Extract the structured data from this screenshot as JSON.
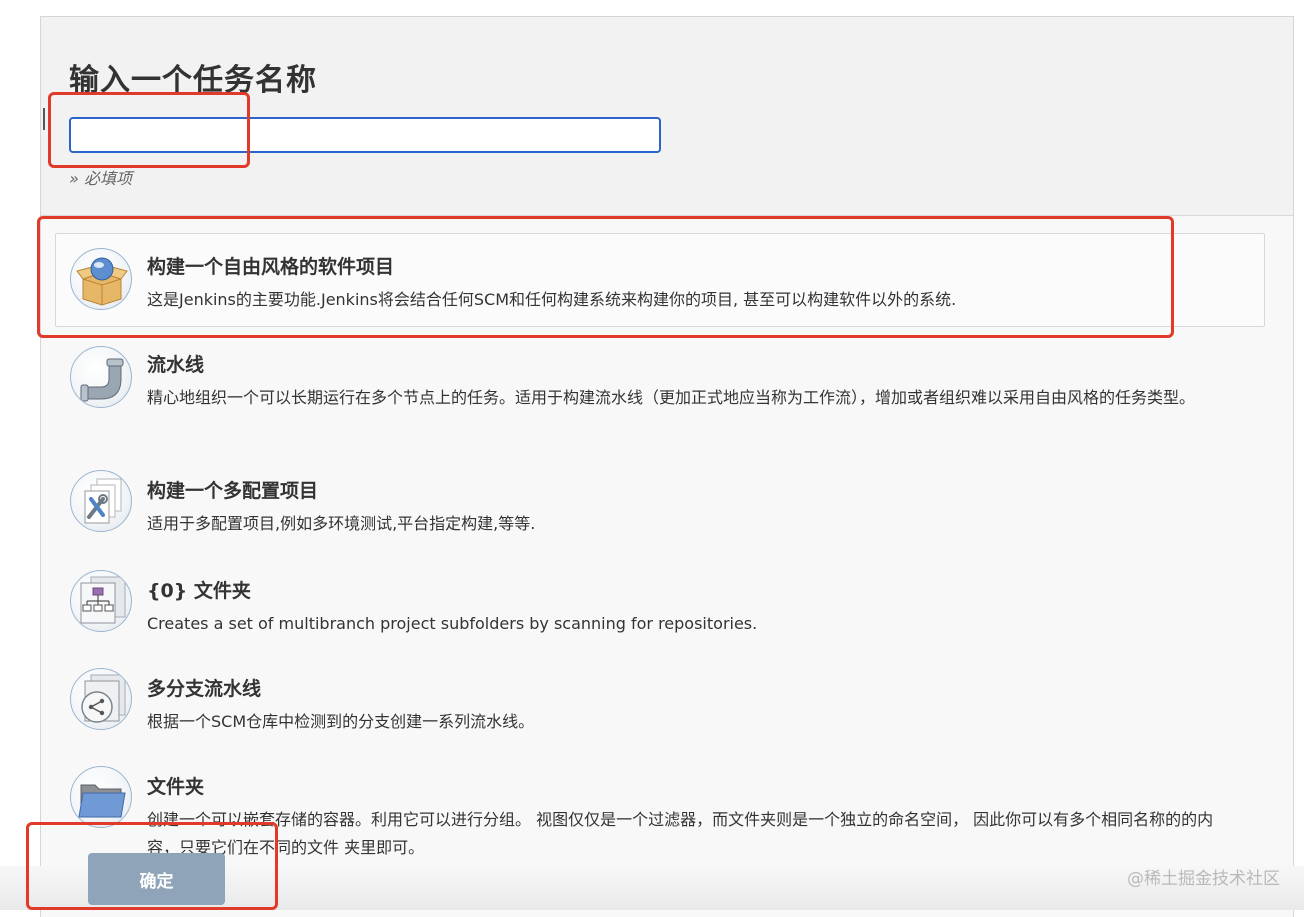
{
  "form": {
    "title": "输入一个任务名称",
    "name_value": "",
    "required_hint": "» 必填项"
  },
  "items": [
    {
      "name": "构建一个自由风格的软件项目",
      "description": "这是Jenkins的主要功能.Jenkins将会结合任何SCM和任何构建系统来构建你的项目, 甚至可以构建软件以外的系统.",
      "icon": "freestyle-box-icon",
      "selected": true
    },
    {
      "name": "流水线",
      "description": "精心地组织一个可以长期运行在多个节点上的任务。适用于构建流水线（更加正式地应当称为工作流），增加或者组织难以采用自由风格的任务类型。",
      "icon": "pipeline-pipe-icon"
    },
    {
      "name": "构建一个多配置项目",
      "description": "适用于多配置项目,例如多环境测试,平台指定构建,等等.",
      "icon": "multi-config-tools-icon"
    },
    {
      "name": "{0} 文件夹",
      "description": "Creates a set of multibranch project subfolders by scanning for repositories.",
      "icon": "org-folder-icon"
    },
    {
      "name": "多分支流水线",
      "description": "根据一个SCM仓库中检测到的分支创建一系列流水线。",
      "icon": "multibranch-icon"
    },
    {
      "name": "文件夹",
      "description": "创建一个可以嵌套存储的容器。利用它可以进行分组。 视图仅仅是一个过滤器，而文件夹则是一个独立的命名空间， 因此你可以有多个相同名称的的内容，只要它们在不同的文件 夹里即可。",
      "icon": "folder-icon"
    }
  ],
  "actions": {
    "ok_label": "确定"
  },
  "watermark": "@稀土掘金技术社区",
  "colors": {
    "focus_border": "#2c64c9",
    "annotation": "#e03a2a",
    "ok_button": "#8fa4b8"
  }
}
